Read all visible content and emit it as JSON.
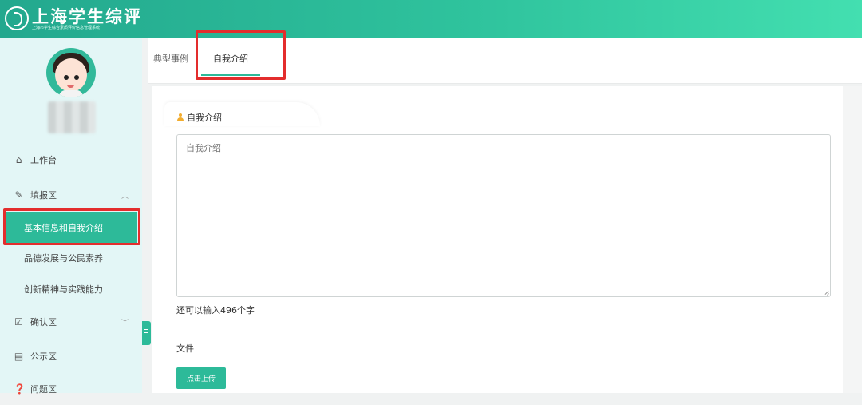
{
  "header": {
    "title": "上海学生综评",
    "subtitle": "上海市学生综合素质评价信息管理系统"
  },
  "sidebar": {
    "items": [
      {
        "label": "工作台",
        "icon": "home-icon"
      },
      {
        "label": "填报区",
        "icon": "edit-icon",
        "expanded": true,
        "children": [
          {
            "label": "基本信息和自我介绍",
            "active": true
          },
          {
            "label": "品德发展与公民素养"
          },
          {
            "label": "创新精神与实践能力"
          }
        ]
      },
      {
        "label": "确认区",
        "icon": "checkbox-icon"
      },
      {
        "label": "公示区",
        "icon": "board-icon"
      },
      {
        "label": "问题区",
        "icon": "question-icon"
      }
    ]
  },
  "tabs": [
    {
      "label": "典型事例"
    },
    {
      "label": "自我介绍",
      "active": true
    }
  ],
  "card": {
    "title": "自我介绍",
    "textarea_placeholder": "自我介绍",
    "counter_text": "还可以输入496个字",
    "file_label": "文件",
    "upload_button": "点击上传"
  },
  "colors": {
    "accent": "#2dba99",
    "highlight": "#e32d2d",
    "header_start": "#23a88e",
    "header_end": "#43dfb0"
  }
}
